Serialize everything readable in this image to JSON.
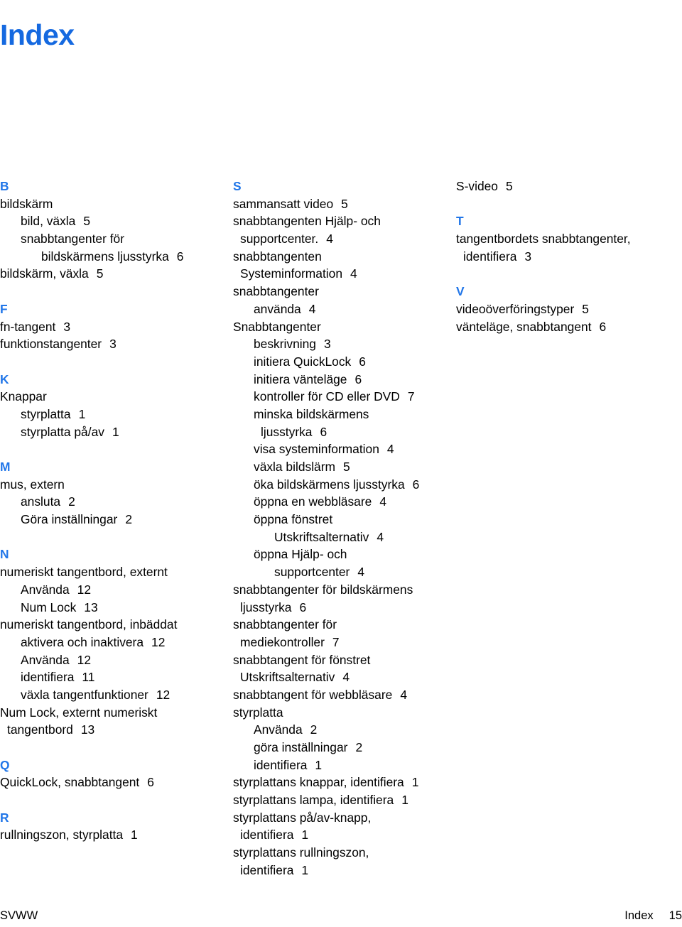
{
  "page": {
    "title": "Index",
    "title_color": "#1569e0",
    "letter_color": "#2176e8",
    "text_color": "#000000",
    "background": "#ffffff"
  },
  "footer": {
    "left": "SVWW",
    "section": "Index",
    "page_number": "15"
  },
  "columns": [
    {
      "id": "column-1",
      "blocks": [
        {
          "letter": "B",
          "entries": [
            {
              "level": 0,
              "text": "bildskärm",
              "page": ""
            },
            {
              "level": 1,
              "text": "bild, växla",
              "page": "5"
            },
            {
              "level": 1,
              "text": "snabbtangenter för",
              "page": ""
            },
            {
              "level": 2,
              "text": "bildskärmens ljusstyrka",
              "page": "6"
            },
            {
              "level": 0,
              "text": "bildskärm, växla",
              "page": "5"
            }
          ]
        },
        {
          "letter": "F",
          "entries": [
            {
              "level": 0,
              "text": "fn-tangent",
              "page": "3"
            },
            {
              "level": 0,
              "text": "funktionstangenter",
              "page": "3"
            }
          ]
        },
        {
          "letter": "K",
          "entries": [
            {
              "level": 0,
              "text": "Knappar",
              "page": ""
            },
            {
              "level": 1,
              "text": "styrplatta",
              "page": "1"
            },
            {
              "level": 1,
              "text": "styrplatta på/av",
              "page": "1"
            }
          ]
        },
        {
          "letter": "M",
          "entries": [
            {
              "level": 0,
              "text": "mus, extern",
              "page": ""
            },
            {
              "level": 1,
              "text": "ansluta",
              "page": "2"
            },
            {
              "level": 1,
              "text": "Göra inställningar",
              "page": "2"
            }
          ]
        },
        {
          "letter": "N",
          "entries": [
            {
              "level": 0,
              "text": "numeriskt tangentbord, externt",
              "page": ""
            },
            {
              "level": 1,
              "text": "Använda",
              "page": "12"
            },
            {
              "level": 1,
              "text": "Num Lock",
              "page": "13"
            },
            {
              "level": 0,
              "text": "numeriskt tangentbord, inbäddat",
              "page": ""
            },
            {
              "level": 1,
              "text": "aktivera och inaktivera",
              "page": "12"
            },
            {
              "level": 1,
              "text": "Använda",
              "page": "12"
            },
            {
              "level": 1,
              "text": "identifiera",
              "page": "11"
            },
            {
              "level": 1,
              "text": "växla tangentfunktioner",
              "page": "12"
            },
            {
              "level": 0,
              "text": "Num Lock, externt numeriskt",
              "page": ""
            },
            {
              "level": "0w",
              "text": "tangentbord",
              "page": "13"
            }
          ]
        },
        {
          "letter": "Q",
          "entries": [
            {
              "level": 0,
              "text": "QuickLock, snabbtangent",
              "page": "6"
            }
          ]
        },
        {
          "letter": "R",
          "entries": [
            {
              "level": 0,
              "text": "rullningszon, styrplatta",
              "page": "1"
            }
          ]
        }
      ]
    },
    {
      "id": "column-2",
      "blocks": [
        {
          "letter": "S",
          "entries": [
            {
              "level": 0,
              "text": "sammansatt video",
              "page": "5"
            },
            {
              "level": 0,
              "text": "snabbtangenten Hjälp- och",
              "page": ""
            },
            {
              "level": "0w",
              "text": "supportcenter.",
              "page": "4"
            },
            {
              "level": 0,
              "text": "snabbtangenten",
              "page": ""
            },
            {
              "level": "0w",
              "text": "Systeminformation",
              "page": "4"
            },
            {
              "level": 0,
              "text": "snabbtangenter",
              "page": ""
            },
            {
              "level": 1,
              "text": "använda",
              "page": "4"
            },
            {
              "level": 0,
              "text": "Snabbtangenter",
              "page": ""
            },
            {
              "level": 1,
              "text": "beskrivning",
              "page": "3"
            },
            {
              "level": 1,
              "text": "initiera QuickLock",
              "page": "6"
            },
            {
              "level": 1,
              "text": "initiera vänteläge",
              "page": "6"
            },
            {
              "level": 1,
              "text": "kontroller för CD eller DVD",
              "page": "7"
            },
            {
              "level": 1,
              "text": "minska bildskärmens",
              "page": ""
            },
            {
              "level": "1w",
              "text": "ljusstyrka",
              "page": "6"
            },
            {
              "level": 1,
              "text": "visa systeminformation",
              "page": "4"
            },
            {
              "level": 1,
              "text": "växla bildslärm",
              "page": "5"
            },
            {
              "level": 1,
              "text": "öka bildskärmens ljusstyrka",
              "page": "6"
            },
            {
              "level": 1,
              "text": "öppna en webbläsare",
              "page": "4"
            },
            {
              "level": 1,
              "text": "öppna fönstret",
              "page": ""
            },
            {
              "level": 2,
              "text": "Utskriftsalternativ",
              "page": "4"
            },
            {
              "level": 1,
              "text": "öppna Hjälp- och",
              "page": ""
            },
            {
              "level": 2,
              "text": "supportcenter",
              "page": "4"
            },
            {
              "level": 0,
              "text": "snabbtangenter för bildskärmens",
              "page": ""
            },
            {
              "level": "0w",
              "text": "ljusstyrka",
              "page": "6"
            },
            {
              "level": 0,
              "text": "snabbtangenter för",
              "page": ""
            },
            {
              "level": "0w",
              "text": "mediekontroller",
              "page": "7"
            },
            {
              "level": 0,
              "text": "snabbtangent för fönstret",
              "page": ""
            },
            {
              "level": "0w",
              "text": "Utskriftsalternativ",
              "page": "4"
            },
            {
              "level": 0,
              "text": "snabbtangent för webbläsare",
              "page": "4"
            },
            {
              "level": 0,
              "text": "styrplatta",
              "page": ""
            },
            {
              "level": 1,
              "text": "Använda",
              "page": "2"
            },
            {
              "level": 1,
              "text": "göra inställningar",
              "page": "2"
            },
            {
              "level": 1,
              "text": "identifiera",
              "page": "1"
            },
            {
              "level": 0,
              "text": "styrplattans knappar, identifiera",
              "page": "1"
            },
            {
              "level": 0,
              "text": "styrplattans lampa, identifiera",
              "page": "1"
            },
            {
              "level": 0,
              "text": "styrplattans på/av-knapp,",
              "page": ""
            },
            {
              "level": "0w",
              "text": "identifiera",
              "page": "1"
            },
            {
              "level": 0,
              "text": "styrplattans rullningszon,",
              "page": ""
            },
            {
              "level": "0w",
              "text": "identifiera",
              "page": "1"
            }
          ]
        }
      ]
    },
    {
      "id": "column-3",
      "blocks": [
        {
          "letter": "",
          "entries": [
            {
              "level": 0,
              "text": "S-video",
              "page": "5"
            }
          ]
        },
        {
          "letter": "T",
          "entries": [
            {
              "level": 0,
              "text": "tangentbordets snabbtangenter,",
              "page": ""
            },
            {
              "level": "0w",
              "text": "identifiera",
              "page": "3"
            }
          ]
        },
        {
          "letter": "V",
          "entries": [
            {
              "level": 0,
              "text": "videoöverföringstyper",
              "page": "5"
            },
            {
              "level": 0,
              "text": "vänteläge, snabbtangent",
              "page": "6"
            }
          ]
        }
      ]
    }
  ]
}
